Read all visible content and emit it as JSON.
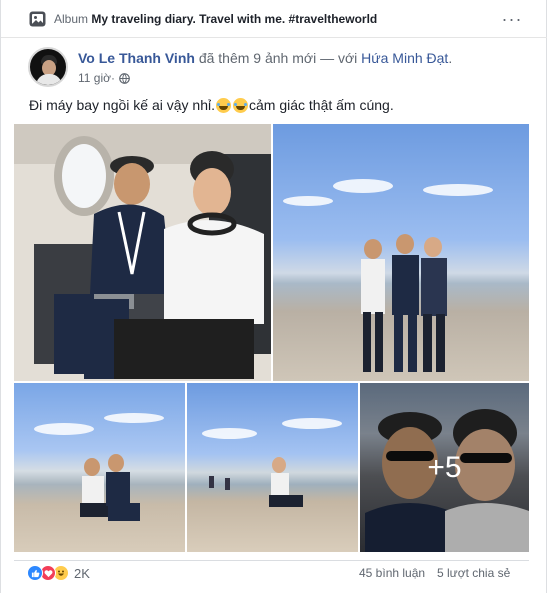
{
  "album": {
    "prefix": "Album",
    "name": "My traveling diary. Travel with me. #traveltheworld",
    "more_label": "···"
  },
  "post": {
    "author": "Vo Le Thanh Vinh",
    "action": " đã thêm 9 ảnh mới — với ",
    "tagged": "Hứa Minh Đạt",
    "period": ".",
    "time": "11 giờ",
    "separator": " · ",
    "privacy_icon": "globe-icon",
    "text_part1": "Đi máy bay ngồi kế ai vậy nhỉ. ",
    "text_part2": " cảm giác thật ấm cúng."
  },
  "photos": {
    "count": 5,
    "more_overlay": "+5"
  },
  "footer": {
    "reaction_types": [
      "like",
      "love",
      "haha"
    ],
    "reaction_count": "2K",
    "comments": "45 bình luận",
    "shares": "5 lượt chia sẻ"
  },
  "colors": {
    "link": "#385898",
    "muted": "#606770",
    "like": "#2d88ff",
    "love": "#f33e58",
    "haha": "#ffcc4d"
  }
}
